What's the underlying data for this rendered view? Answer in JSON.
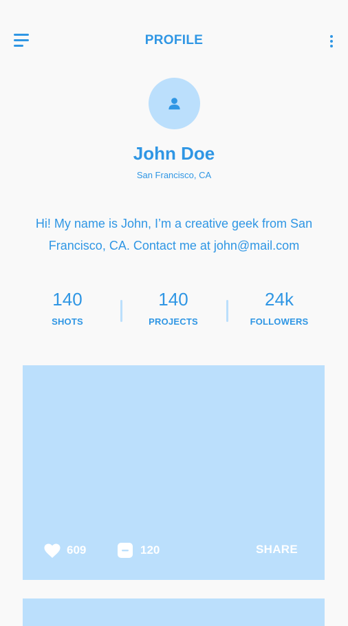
{
  "header": {
    "title": "PROFILE",
    "menu_icon": "hamburger-menu-icon",
    "more_icon": "vertical-dots-icon"
  },
  "profile": {
    "avatar_icon": "person-icon",
    "name": "John Doe",
    "location": "San Francisco, CA",
    "bio": "Hi! My name is John, I’m a creative geek from San Francisco, CA. Contact me at john@mail.com"
  },
  "stats": [
    {
      "value": "140",
      "label": "SHOTS"
    },
    {
      "value": "140",
      "label": "PROJECTS"
    },
    {
      "value": "24k",
      "label": "FOLLOWERS"
    }
  ],
  "posts": [
    {
      "likes": "609",
      "comments": "120",
      "share_label": "SHARE"
    }
  ],
  "colors": {
    "accent": "#2f96e4",
    "light_accent": "#bbdffc",
    "background": "#f9f9f9",
    "card_text": "#ffffff"
  }
}
